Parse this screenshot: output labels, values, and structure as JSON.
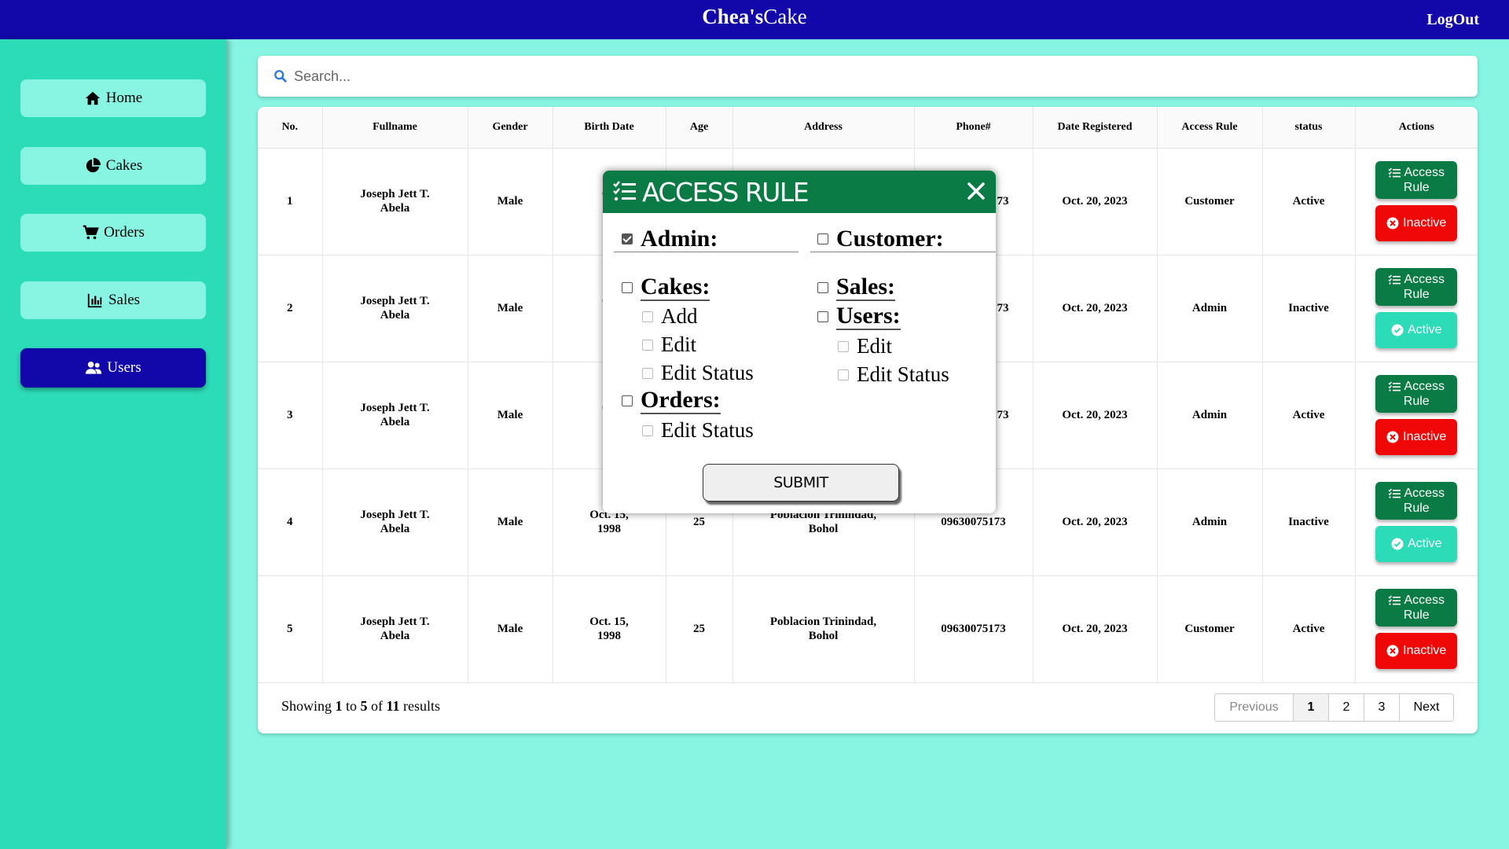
{
  "app": {
    "brand_bold": "Chea's",
    "brand_rest": "Cake",
    "logout_label": "LogOut"
  },
  "sidebar": {
    "items": [
      {
        "label": "Home",
        "icon": "home-icon"
      },
      {
        "label": "Cakes",
        "icon": "pie-chart-icon"
      },
      {
        "label": "Orders",
        "icon": "cart-icon"
      },
      {
        "label": "Sales",
        "icon": "bar-chart-icon"
      },
      {
        "label": "Users",
        "icon": "users-icon",
        "active": true
      }
    ]
  },
  "search": {
    "placeholder": "Search..."
  },
  "table": {
    "headers": [
      "No.",
      "Fullname",
      "Gender",
      "Birth Date",
      "Age",
      "Address",
      "Phone#",
      "Date Registered",
      "Access Rule",
      "status",
      "Actions"
    ],
    "rows": [
      {
        "no": "1",
        "name1": "Joseph Jett T.",
        "name2": "Abela",
        "gender": "Male",
        "birth1": "Oc",
        "birth2": "1",
        "age": "",
        "addr1": "",
        "addr2": "",
        "phone": "73",
        "registered": "Oct. 20, 2023",
        "rule": "Customer",
        "status": "Active",
        "action_access": [
          "Access",
          "Rule"
        ],
        "action_status": "Inactive"
      },
      {
        "no": "2",
        "name1": "Joseph Jett T.",
        "name2": "Abela",
        "gender": "Male",
        "birth1": "Oc",
        "birth2": "1",
        "age": "",
        "addr1": "",
        "addr2": "",
        "phone": "73",
        "registered": "Oct. 20, 2023",
        "rule": "Admin",
        "status": "Inactive",
        "action_access": [
          "Access",
          "Rule"
        ],
        "action_status": "Active"
      },
      {
        "no": "3",
        "name1": "Joseph Jett T.",
        "name2": "Abela",
        "gender": "Male",
        "birth1": "Oc",
        "birth2": "1",
        "age": "",
        "addr1": "",
        "addr2": "",
        "phone": "73",
        "registered": "Oct. 20, 2023",
        "rule": "Admin",
        "status": "Active",
        "action_access": [
          "Access",
          "Rule"
        ],
        "action_status": "Inactive"
      },
      {
        "no": "4",
        "name1": "Joseph Jett T.",
        "name2": "Abela",
        "gender": "Male",
        "birth1": "Oct. 15,",
        "birth2": "1998",
        "age": "25",
        "addr1": "Poblacion Trinindad,",
        "addr2": "Bohol",
        "phone": "09630075173",
        "registered": "Oct. 20, 2023",
        "rule": "Admin",
        "status": "Inactive",
        "action_access": [
          "Access",
          "Rule"
        ],
        "action_status": "Active"
      },
      {
        "no": "5",
        "name1": "Joseph Jett T.",
        "name2": "Abela",
        "gender": "Male",
        "birth1": "Oct. 15,",
        "birth2": "1998",
        "age": "25",
        "addr1": "Poblacion Trinindad,",
        "addr2": "Bohol",
        "phone": "09630075173",
        "registered": "Oct. 20, 2023",
        "rule": "Customer",
        "status": "Active",
        "action_access": [
          "Access",
          "Rule"
        ],
        "action_status": "Inactive"
      }
    ]
  },
  "footer": {
    "showing": "Showing",
    "from": "1",
    "to_word": "to",
    "to": "5",
    "of_word": "of",
    "total": "11",
    "results": "results"
  },
  "pagination": {
    "prev": "Previous",
    "pages": [
      "1",
      "2",
      "3"
    ],
    "current": "1",
    "next": "Next"
  },
  "modal": {
    "title": "ACCESS RULE",
    "admin": {
      "label": "Admin:",
      "checked": true
    },
    "customer": {
      "label": "Customer:",
      "checked": false
    },
    "cakes": {
      "label": "Cakes:",
      "subs": [
        "Add",
        "Edit",
        "Edit Status"
      ]
    },
    "orders": {
      "label": "Orders:",
      "subs": [
        "Edit Status"
      ]
    },
    "sales": {
      "label": "Sales:"
    },
    "users": {
      "label": "Users:",
      "subs": [
        "Edit",
        "Edit Status"
      ]
    },
    "submit_label": "SUBMIT"
  },
  "colors": {
    "topbar": "#1207a8",
    "sidebar": "#2cdbb8",
    "background": "#87f5e2",
    "access_button": "#0a7b45",
    "inactive_button": "#f00808",
    "active_button": "#2cdbb8"
  }
}
